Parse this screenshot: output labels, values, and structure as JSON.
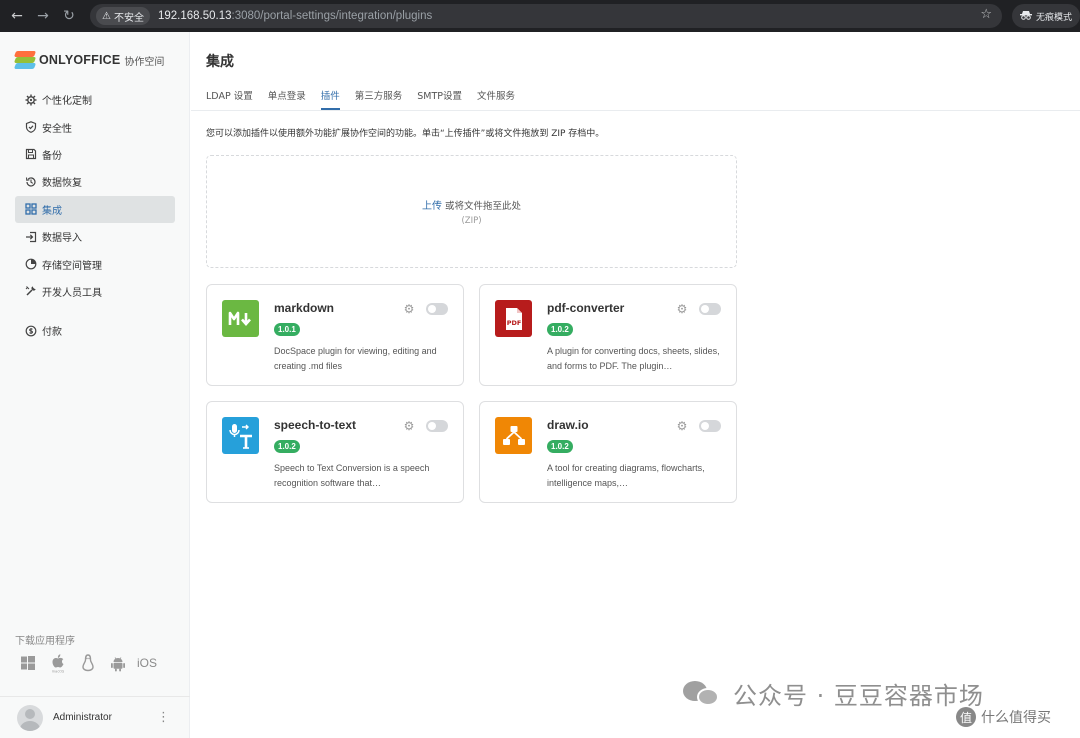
{
  "browser": {
    "insecure_label": "不安全",
    "url_host": "192.168.50.13",
    "url_path": ":3080/portal-settings/integration/plugins",
    "incognito_label": "无痕模式"
  },
  "sidebar": {
    "logo_text": "ONLYOFFICE",
    "logo_sub": "协作空间",
    "items": [
      {
        "label": "个性化定制",
        "icon": "gear-icon"
      },
      {
        "label": "安全性",
        "icon": "shield-icon"
      },
      {
        "label": "备份",
        "icon": "save-icon"
      },
      {
        "label": "数据恢复",
        "icon": "restore-icon"
      },
      {
        "label": "集成",
        "icon": "integration-icon",
        "active": true
      },
      {
        "label": "数据导入",
        "icon": "import-icon"
      },
      {
        "label": "存储空间管理",
        "icon": "storage-icon"
      },
      {
        "label": "开发人员工具",
        "icon": "developer-icon"
      },
      {
        "label": "付款",
        "icon": "payment-icon"
      }
    ],
    "download_label": "下载应用程序",
    "os": [
      "windows",
      "macos",
      "linux",
      "android",
      "iOS"
    ],
    "user_name": "Administrator"
  },
  "main": {
    "title": "集成",
    "tabs": [
      {
        "label": "LDAP 设置"
      },
      {
        "label": "单点登录"
      },
      {
        "label": "插件",
        "active": true
      },
      {
        "label": "第三方服务"
      },
      {
        "label": "SMTP设置"
      },
      {
        "label": "文件服务"
      }
    ],
    "description": "您可以添加插件以使用额外功能扩展协作空间的功能。单击“上传插件”或将文件拖放到 ZIP 存档中。",
    "dropzone": {
      "link": "上传",
      "text": " 或将文件拖至此处",
      "hint": "(ZIP)"
    },
    "plugins": [
      {
        "name": "markdown",
        "version": "1.0.1",
        "description": "DocSpace plugin for viewing, editing and creating .md files",
        "icon_color": "#6bb842",
        "enabled": false
      },
      {
        "name": "pdf-converter",
        "version": "1.0.2",
        "description": "A plugin for converting docs, sheets, slides, and forms to PDF. The plugin…",
        "icon_color": "#b71c1c",
        "enabled": false
      },
      {
        "name": "speech-to-text",
        "version": "1.0.2",
        "description": "Speech to Text Conversion is a speech recognition software that…",
        "icon_color": "#26a0da",
        "enabled": false
      },
      {
        "name": "draw.io",
        "version": "1.0.2",
        "description": "A tool for creating diagrams, flowcharts, intelligence maps,…",
        "icon_color": "#f08705",
        "enabled": false
      }
    ]
  },
  "watermark": {
    "text": "公众号 · 豆豆容器市场",
    "text2": "什么值得买"
  }
}
